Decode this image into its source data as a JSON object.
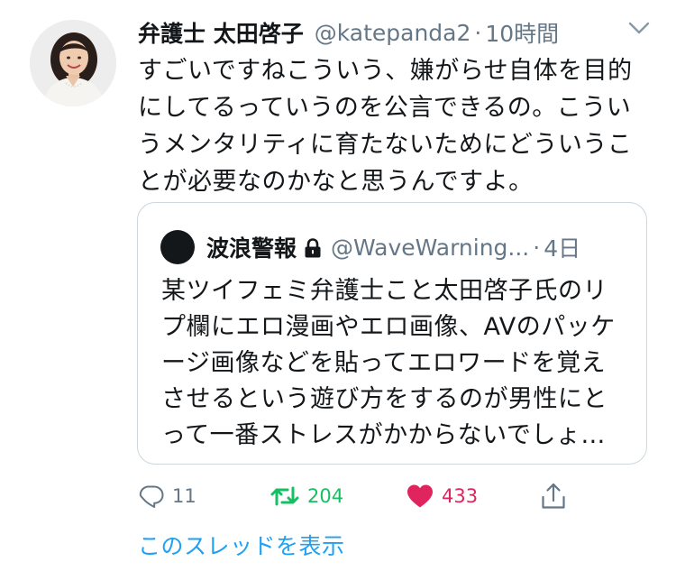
{
  "tweet": {
    "display_name": "弁護士 太田啓子",
    "handle": "@katepanda2",
    "separator": "·",
    "time": "10時間",
    "text": "すごいですねこういう、嫌がらせ自体を目的にしてるっていうのを公言できるの。こういうメンタリティに育たないためにどういうことが必要なのかなと思うんですよ。"
  },
  "quote": {
    "display_name": "波浪警報",
    "handle": "@WaveWarning...",
    "separator": "·",
    "time": "4日",
    "protected_icon": "lock-icon",
    "text": "某ツイフェミ弁護士こと太田啓子氏のリプ欄にエロ漫画やエロ画像、AVのパッケージ画像などを貼ってエロワードを覚えさせるという遊び方をするのが男性にとって一番ストレスがかからないでしょ…"
  },
  "actions": {
    "reply_count": "11",
    "retweet_count": "204",
    "like_count": "433",
    "retweeted": true,
    "liked": true
  },
  "thread_link": "このスレッドを表示",
  "icons": {
    "menu": "chevron-down-icon",
    "reply": "reply-icon",
    "retweet": "retweet-icon",
    "like": "heart-icon",
    "share": "share-icon"
  },
  "colors": {
    "retweet_active": "#17bf63",
    "like_active": "#e0245e",
    "link": "#1da1f2",
    "secondary_text": "#657786",
    "border": "#ccd6dd"
  }
}
